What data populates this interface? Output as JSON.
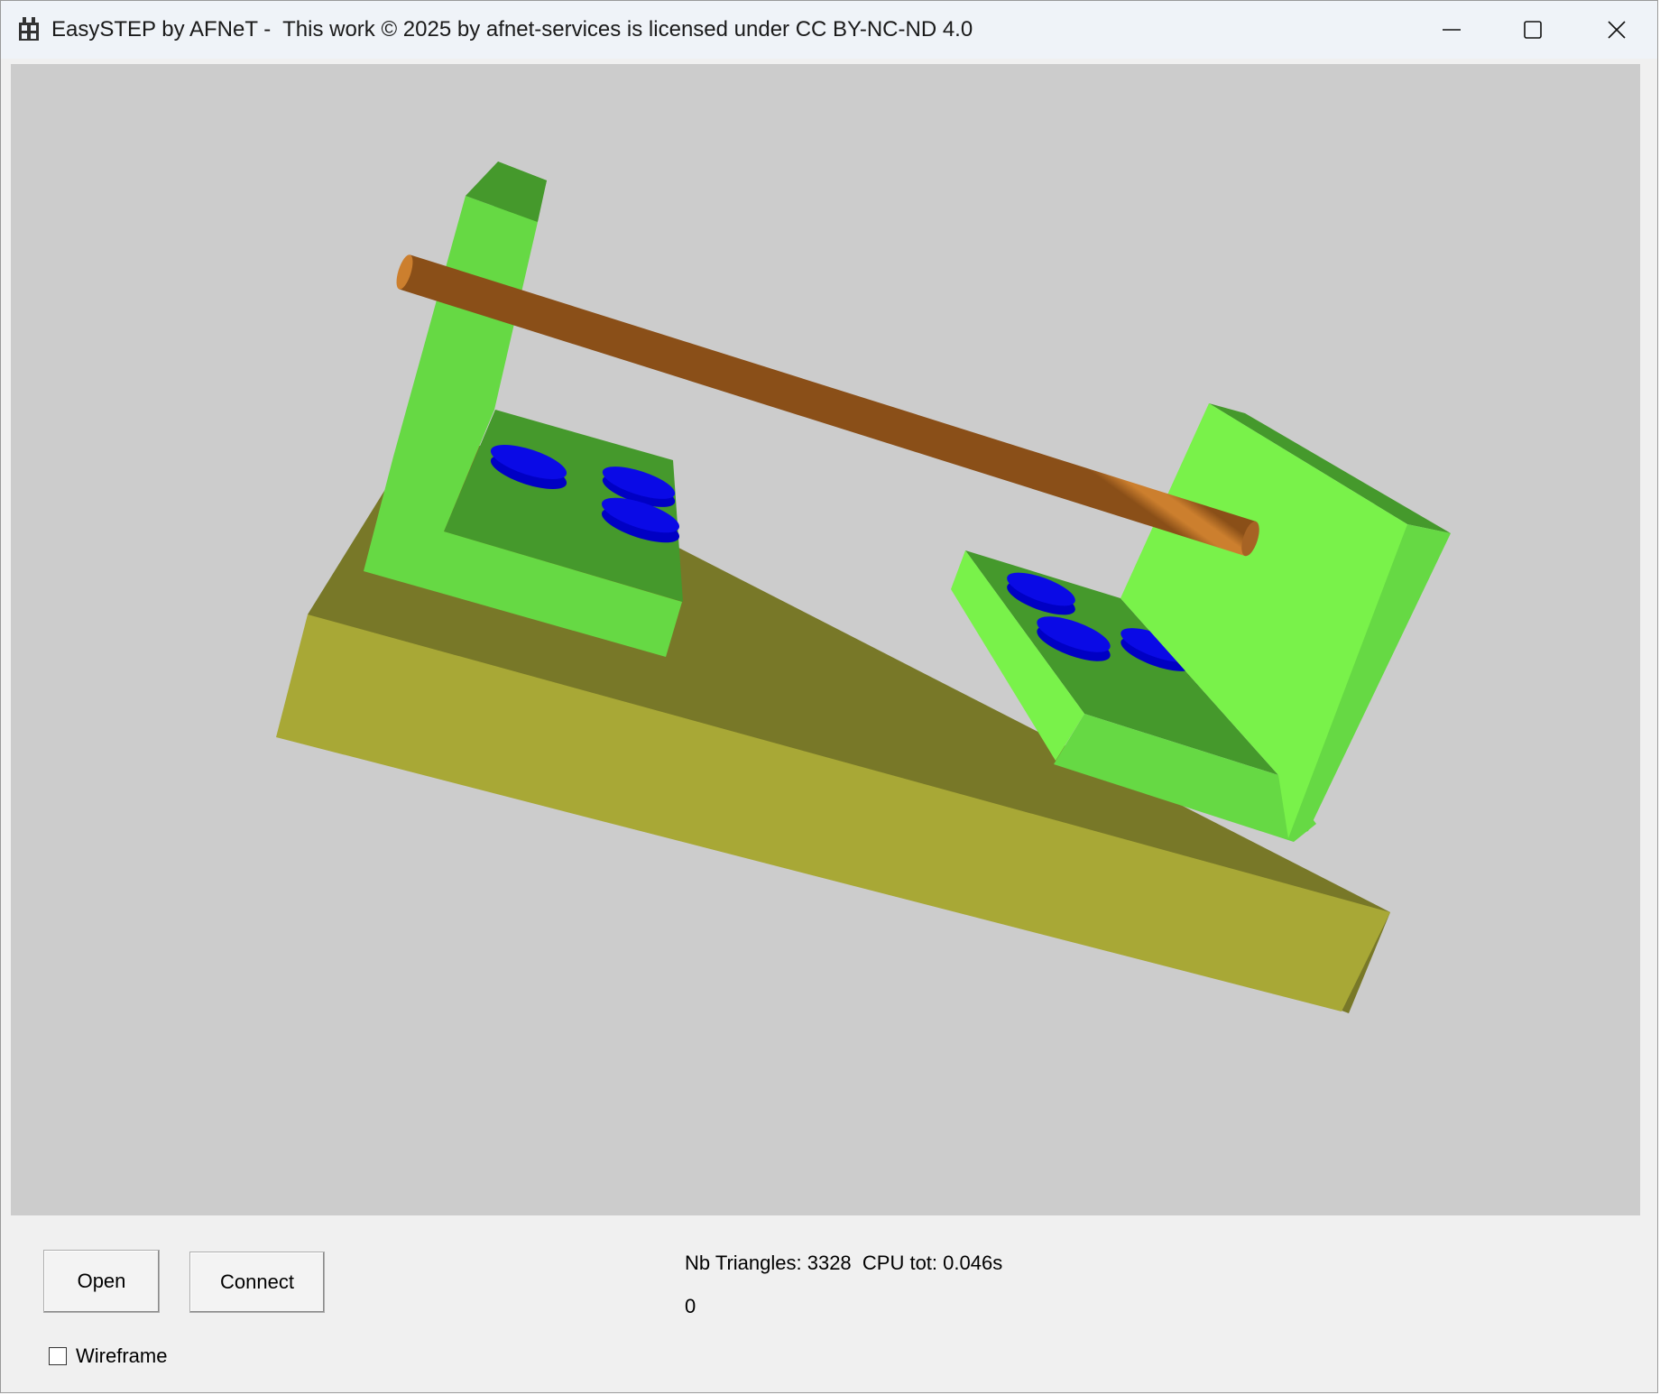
{
  "window": {
    "title": "EasySTEP by AFNeT -  This work © 2025 by afnet-services is licensed under CC BY-NC-ND 4.0",
    "controls": {
      "minimize_icon": "minimize-icon",
      "maximize_icon": "maximize-icon",
      "close_icon": "close-icon"
    }
  },
  "viewport": {
    "background": "#cccccc",
    "model_colors": {
      "base_top": "#787828",
      "base_front": "#a8a836",
      "bracket_light": "#66d944",
      "bracket_bright": "#79f24a",
      "bracket_dark": "#45992c",
      "rod": "#cc7f2e",
      "discs": "#0a0ae6"
    }
  },
  "controls": {
    "open_label": "Open",
    "connect_label": "Connect",
    "wireframe_label": "Wireframe",
    "wireframe_checked": false
  },
  "status": {
    "stats": "Nb Triangles: 3328  CPU tot: 0.046s",
    "counter": "0"
  }
}
